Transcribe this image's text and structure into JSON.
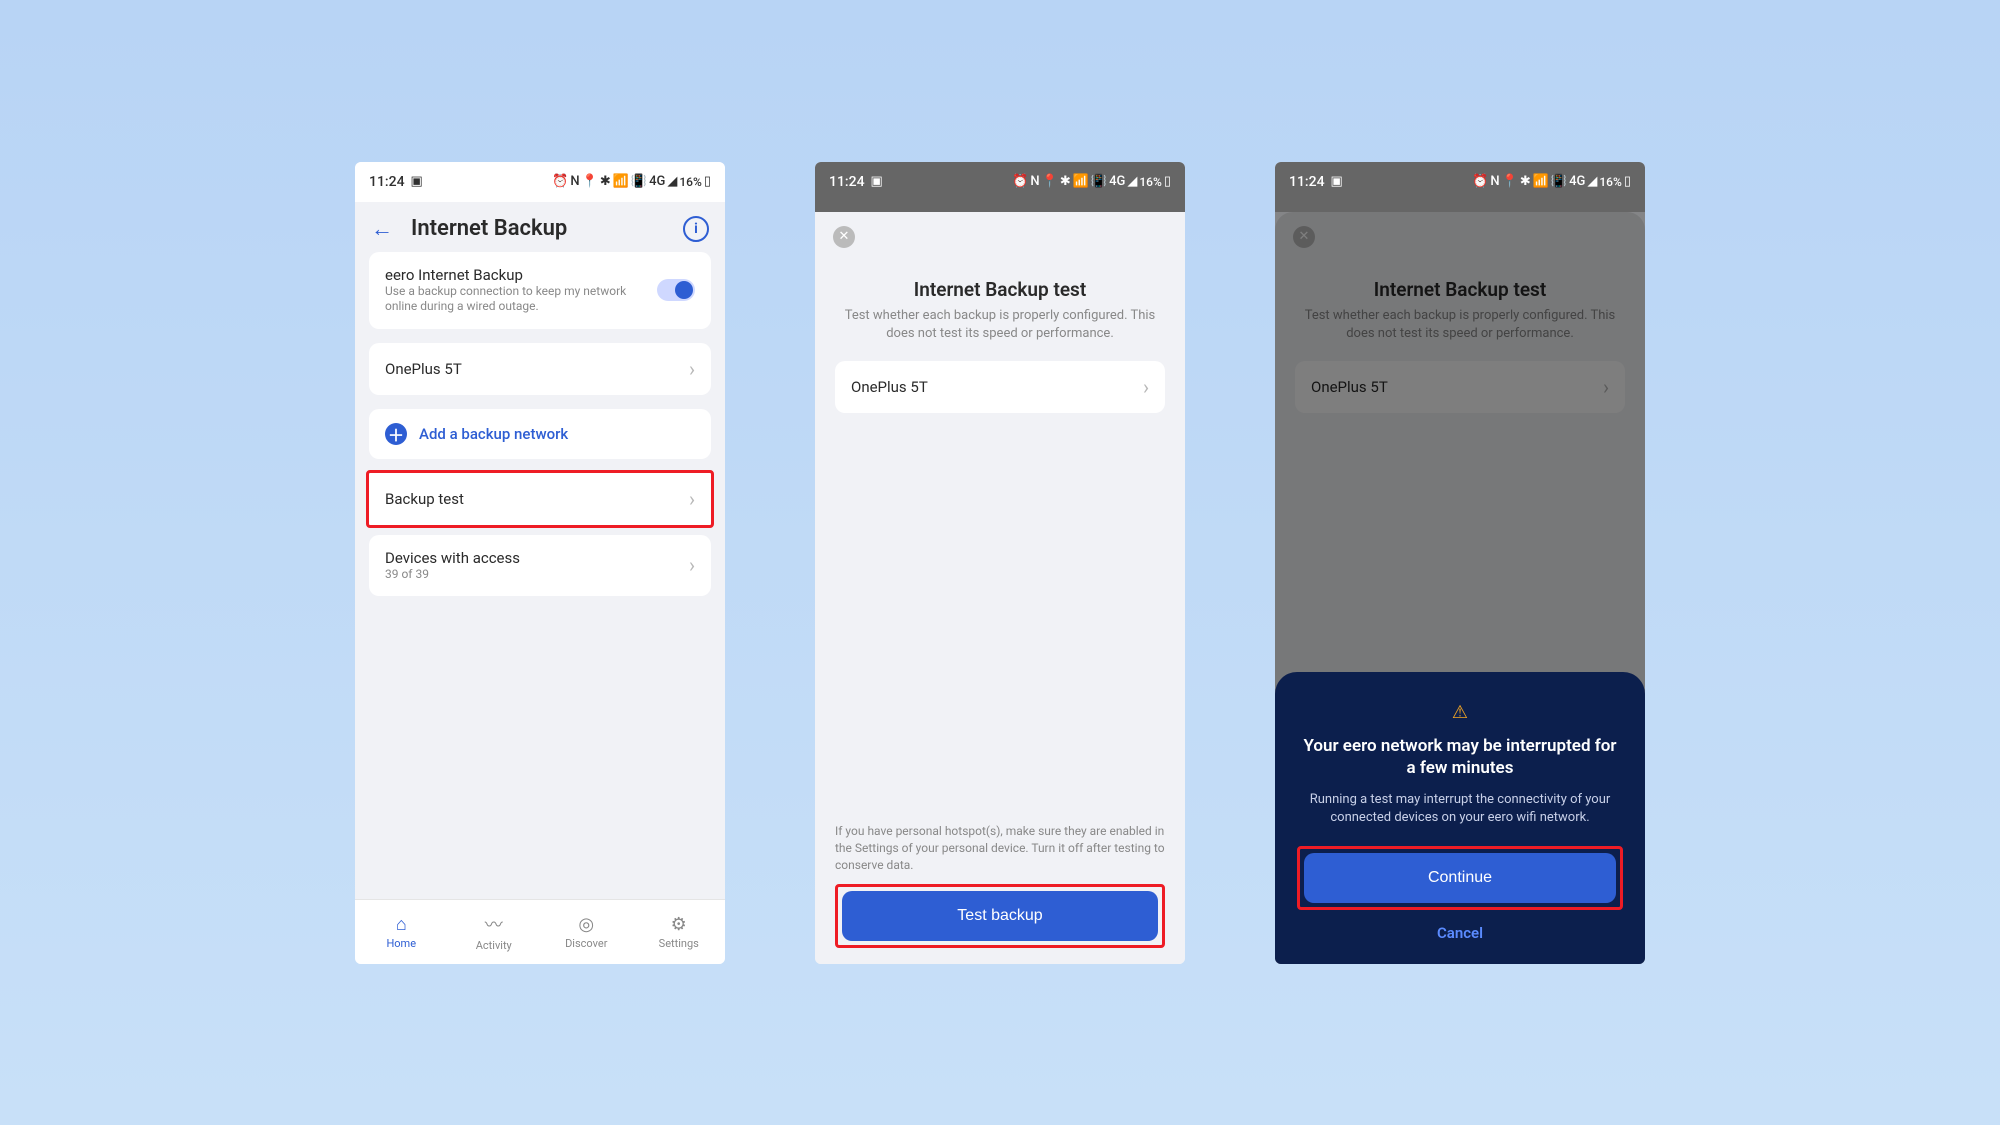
{
  "status_bar": {
    "time": "11:24",
    "battery": "16%",
    "lte": "4G"
  },
  "screen1": {
    "title": "Internet Backup",
    "backup_card": {
      "title": "eero Internet Backup",
      "subtitle": "Use a backup connection to keep my network online during a wired outage."
    },
    "backup_item": "OnePlus 5T",
    "add_backup": "Add a backup network",
    "backup_test": "Backup test",
    "devices": {
      "title": "Devices with access",
      "subtitle": "39 of 39"
    },
    "nav": {
      "home": "Home",
      "activity": "Activity",
      "discover": "Discover",
      "settings": "Settings"
    }
  },
  "screen2": {
    "title": "Internet Backup test",
    "desc": "Test whether each backup is properly configured. This does not test its speed or performance.",
    "item": "OnePlus 5T",
    "hint": "If you have personal hotspot(s), make sure they are enabled in the Settings of your personal device. Turn it off after testing to conserve data.",
    "button": "Test backup"
  },
  "screen3": {
    "title": "Internet Backup test",
    "desc": "Test whether each backup is properly configured. This does not test its speed or performance.",
    "item": "OnePlus 5T",
    "dialog": {
      "title": "Your eero network may be interrupted for a few minutes",
      "desc": "Running a test may interrupt the connectivity of your connected devices on your eero wifi network.",
      "continue": "Continue",
      "cancel": "Cancel"
    }
  }
}
